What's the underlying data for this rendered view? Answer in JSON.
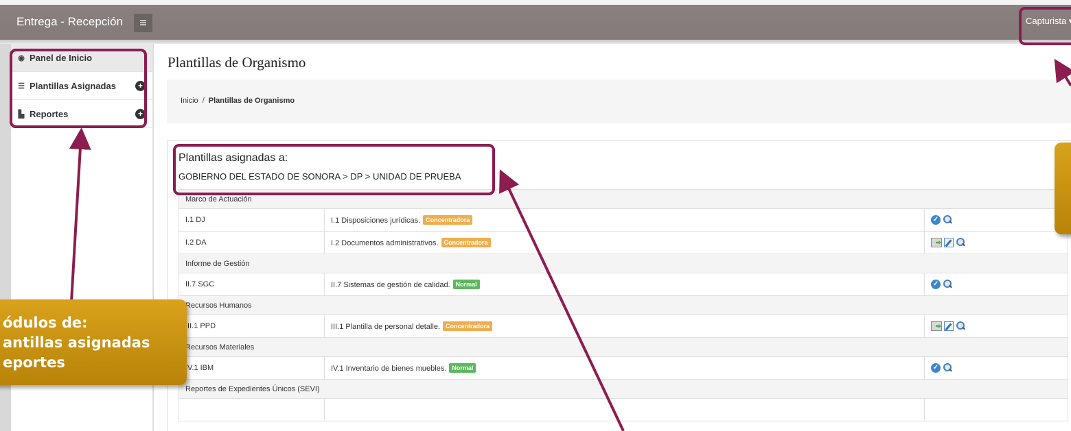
{
  "header": {
    "app_title": "Entrega - Recepción",
    "menu_icon": "hamburger-icon",
    "user_menu": "Capturista"
  },
  "sidebar": {
    "items": [
      {
        "label": "Panel de Inicio",
        "icon": "dashboard-icon"
      },
      {
        "label": "Plantillas Asignadas",
        "icon": "list-icon"
      },
      {
        "label": "Reportes",
        "icon": "file-icon"
      }
    ]
  },
  "main": {
    "page_title": "Plantillas de Organismo",
    "breadcrumb": {
      "home": "Inicio",
      "separator": "/",
      "current": "Plantillas de Organismo"
    },
    "panel": {
      "title": "Plantillas asignadas a:",
      "path": "GOBIERNO DEL ESTADO DE SONORA > DP > UNIDAD DE PRUEBA",
      "groups": [
        {
          "name": "Marco de Actuación",
          "rows": [
            {
              "code": "I.1 DJ",
              "description": "I.1 Disposiciones jurídicas.",
              "badge": "Concentradora"
            },
            {
              "code": "I.2 DA",
              "description": "I.2 Documentos administrativos.",
              "badge": "Concentradora"
            }
          ]
        },
        {
          "name": "Informe de Gestión",
          "rows": [
            {
              "code": "II.7 SGC",
              "description": "II.7 Sistemas de gestión de calidad.",
              "badge": "Normal"
            }
          ]
        },
        {
          "name": "Recursos Humanos",
          "rows": [
            {
              "code": "III.1 PPD",
              "description": "III.1 Plantilla de personal detalle.",
              "badge": "Concentradora"
            }
          ]
        },
        {
          "name": "Recursos Materiales",
          "rows": [
            {
              "code": "IV.1 IBM",
              "description": "IV.1 Inventario de bienes muebles.",
              "badge": "Normal"
            }
          ]
        },
        {
          "name": "Reportes de Expedientes Únicos (SEVI)",
          "rows": []
        }
      ]
    }
  },
  "callouts": {
    "left_line1": "ódulos de:",
    "left_line2": "antillas asignadas",
    "left_line3": "eportes"
  },
  "colors": {
    "header_bg": "#857a7a",
    "highlight_border": "#8c1d4f",
    "callout_bg": "#c8920f",
    "badge_concentradora": "#f0ad4e",
    "badge_normal": "#5cb85c",
    "check_icon": "#3a88cc"
  }
}
